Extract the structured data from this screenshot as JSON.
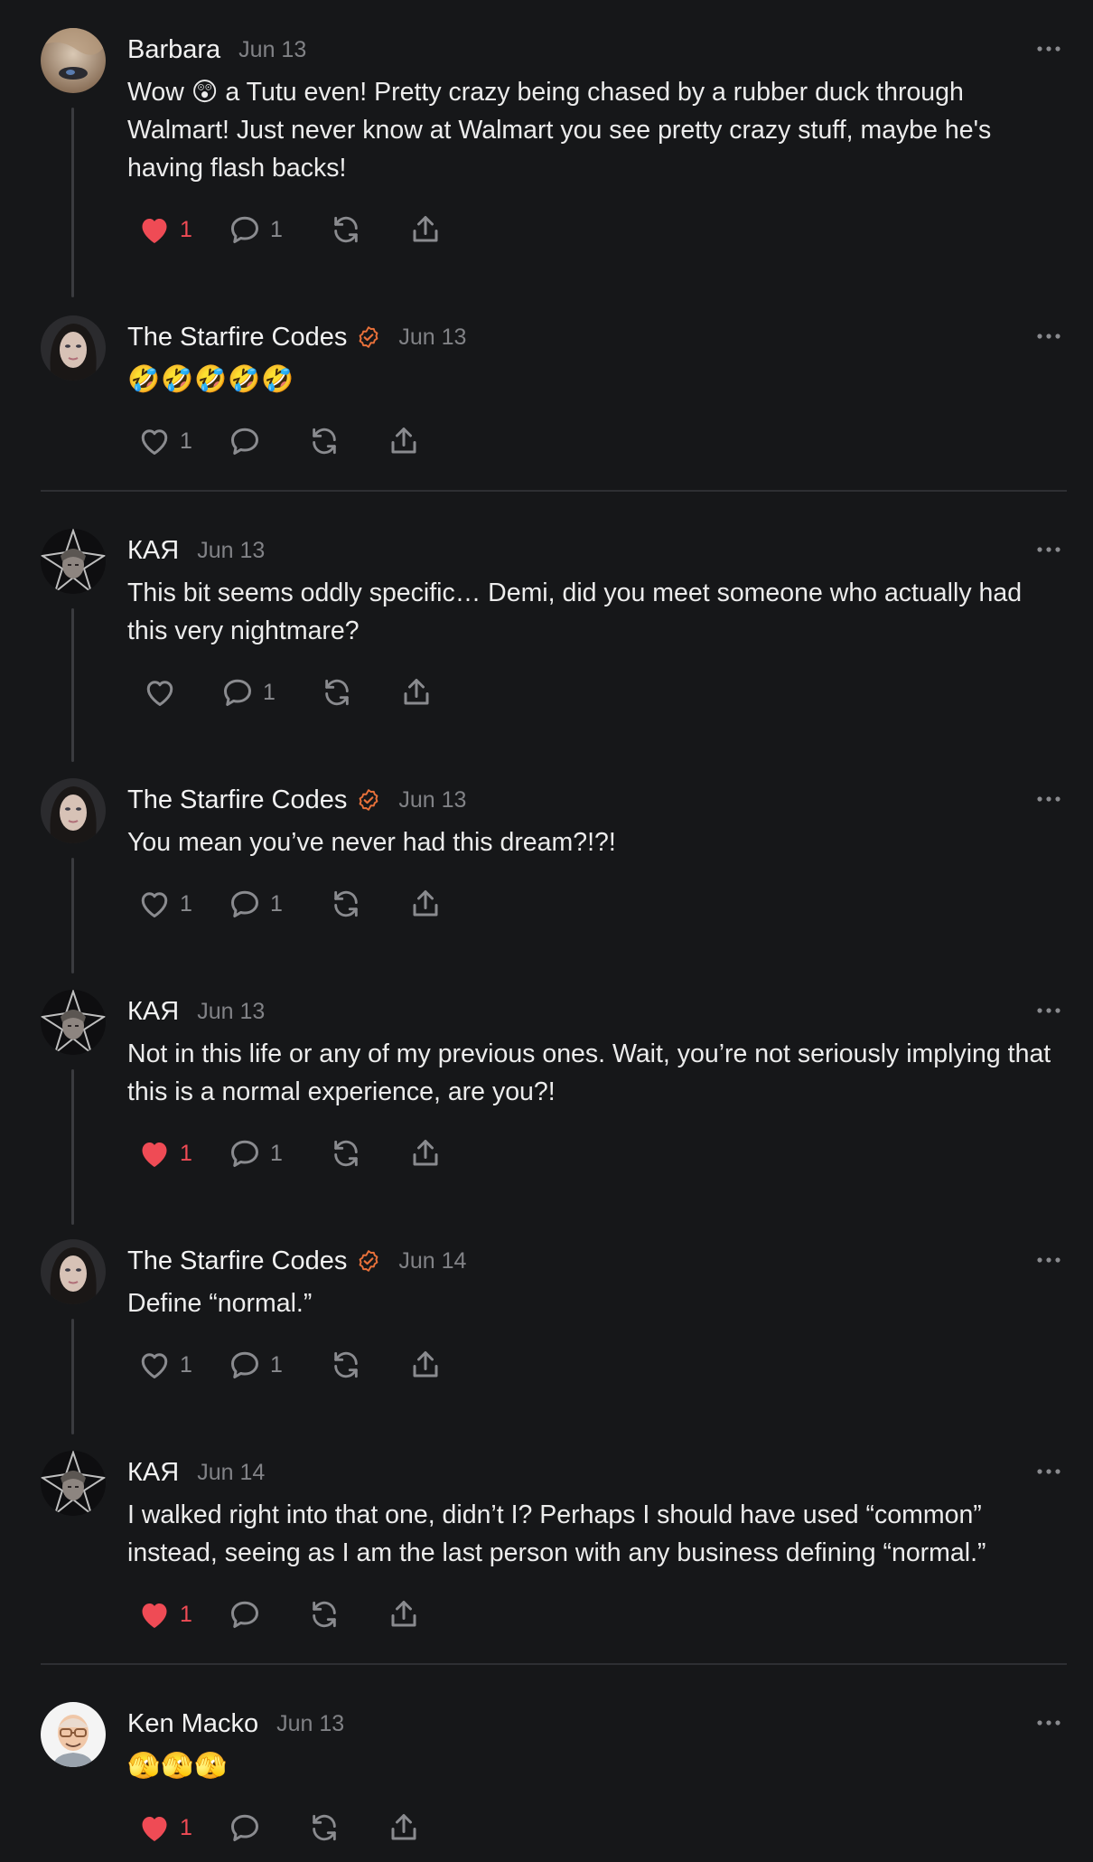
{
  "colors": {
    "background": "#161719",
    "accent_verified": "#e9713a",
    "like_active": "#ef4b55",
    "icon_muted": "#8a8b8f",
    "thread_line": "#3a3b3f"
  },
  "posts": [
    {
      "author": "Barbara",
      "date": "Jun 13",
      "verified": false,
      "avatar": "barbara-avatar",
      "text": "Wow 😲 a Tutu even! Pretty crazy being chased by a rubber duck through Walmart! Just never know at Walmart you see pretty crazy stuff, maybe he's having flash backs!",
      "liked": true,
      "likes": "1",
      "replies": "1"
    },
    {
      "author": "The Starfire Codes",
      "date": "Jun 13",
      "verified": true,
      "avatar": "starfire-avatar",
      "text": "🤣🤣🤣🤣🤣",
      "liked": false,
      "likes": "1",
      "replies": ""
    },
    {
      "author": "КАЯ",
      "date": "Jun 13",
      "verified": false,
      "avatar": "kaya-avatar",
      "text": "This bit seems oddly specific… Demi, did you meet someone who actually had this very nightmare?",
      "liked": false,
      "likes": "",
      "replies": "1"
    },
    {
      "author": "The Starfire Codes",
      "date": "Jun 13",
      "verified": true,
      "avatar": "starfire-avatar",
      "text": "You mean you’ve never had this dream?!?!",
      "liked": false,
      "likes": "1",
      "replies": "1"
    },
    {
      "author": "КАЯ",
      "date": "Jun 13",
      "verified": false,
      "avatar": "kaya-avatar",
      "text": "Not in this life or any of my previous ones. Wait, you’re not seriously implying that this is a normal experience, are you?!",
      "liked": true,
      "likes": "1",
      "replies": "1"
    },
    {
      "author": "The Starfire Codes",
      "date": "Jun 14",
      "verified": true,
      "avatar": "starfire-avatar",
      "text": "Define “normal.”",
      "liked": false,
      "likes": "1",
      "replies": "1"
    },
    {
      "author": "КАЯ",
      "date": "Jun 14",
      "verified": false,
      "avatar": "kaya-avatar",
      "text": "I walked right into that one, didn’t I? Perhaps I should have used “common” instead, seeing as I am the last person with any business defining “normal.”",
      "liked": true,
      "likes": "1",
      "replies": ""
    },
    {
      "author": "Ken Macko",
      "date": "Jun 13",
      "verified": false,
      "avatar": "ken-avatar",
      "text": "🫣🫣🫣",
      "liked": true,
      "likes": "1",
      "replies": ""
    }
  ]
}
